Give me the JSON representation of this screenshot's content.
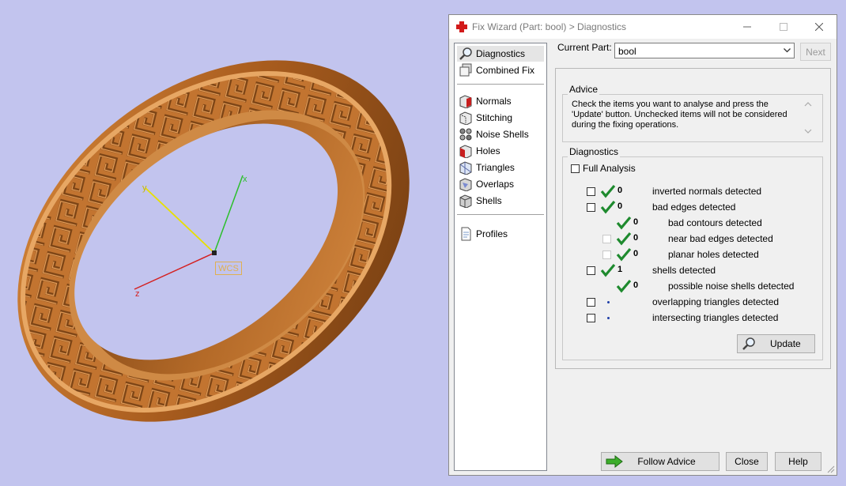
{
  "window": {
    "title": "Fix Wizard (Part: bool) > Diagnostics"
  },
  "viewport": {
    "axes": {
      "x": "x",
      "y": "y",
      "z": "z"
    },
    "wcs_label": "WCS",
    "colors": {
      "background": "#c2c4ee",
      "ring": "#c8742a",
      "x_axis": "#2bbf2b",
      "y_axis": "#e8e000",
      "z_axis": "#d42020"
    }
  },
  "nav": {
    "top": [
      {
        "label": "Diagnostics",
        "icon": "magnifier-icon"
      },
      {
        "label": "Combined Fix",
        "icon": "combined-fix-icon"
      }
    ],
    "tools": [
      {
        "label": "Normals",
        "icon": "normals-icon"
      },
      {
        "label": "Stitching",
        "icon": "stitching-icon"
      },
      {
        "label": "Noise Shells",
        "icon": "noise-shells-icon"
      },
      {
        "label": "Holes",
        "icon": "holes-icon"
      },
      {
        "label": "Triangles",
        "icon": "triangles-icon"
      },
      {
        "label": "Overlaps",
        "icon": "overlaps-icon"
      },
      {
        "label": "Shells",
        "icon": "shells-icon"
      }
    ],
    "bottom": [
      {
        "label": "Profiles",
        "icon": "profiles-icon"
      }
    ]
  },
  "current_part": {
    "label": "Current Part:",
    "value": "bool",
    "next": "Next"
  },
  "advice": {
    "title": "Advice",
    "text": "Check the items you want to analyse and press the 'Update' button. Unchecked items will not be considered during the fixing operations."
  },
  "diagnostics": {
    "title": "Diagnostics",
    "full_analysis": "Full Analysis",
    "rows": [
      {
        "count": "0",
        "label": "inverted normals detected"
      },
      {
        "count": "0",
        "label": "bad edges detected"
      },
      {
        "count": "0",
        "label": "bad contours detected"
      },
      {
        "count": "0",
        "label": "near bad edges detected"
      },
      {
        "count": "0",
        "label": "planar holes detected"
      },
      {
        "count": "1",
        "label": "shells detected"
      },
      {
        "count": "0",
        "label": "possible noise shells detected"
      },
      {
        "count": "",
        "label": "overlapping triangles detected"
      },
      {
        "count": "",
        "label": "intersecting triangles detected"
      }
    ],
    "update": "Update"
  },
  "footer": {
    "follow_advice": "Follow Advice",
    "close": "Close",
    "help": "Help"
  }
}
